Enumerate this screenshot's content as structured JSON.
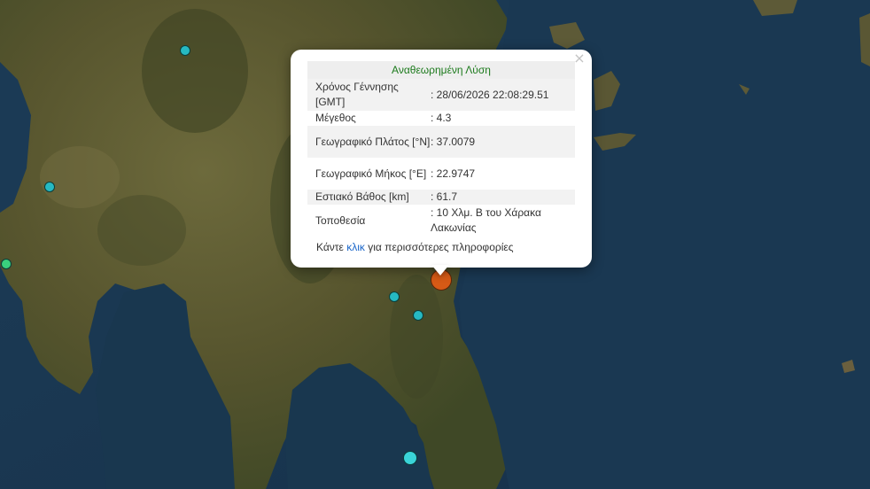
{
  "map": {
    "markers": [
      {
        "id": "m1",
        "size": "small",
        "color": "#26b9c2"
      },
      {
        "id": "m2",
        "size": "small",
        "color": "#26b9c2"
      },
      {
        "id": "m3",
        "size": "small",
        "color": "#3ad07d"
      },
      {
        "id": "m4",
        "size": "small",
        "color": "#3ad07d"
      },
      {
        "id": "m5",
        "size": "small",
        "color": "#26b9c2"
      },
      {
        "id": "m6",
        "size": "small",
        "color": "#26b9c2"
      },
      {
        "id": "m7",
        "size": "small",
        "color": "#3ad3d8"
      },
      {
        "id": "m8",
        "size": "large",
        "color": "#d65a16"
      }
    ]
  },
  "popup": {
    "close_icon": "×",
    "title": "Αναθεωρημένη Λύση",
    "rows": [
      {
        "label": "Χρόνος Γέννησης [GMT]",
        "value": ": 28/06/2026 22:08:29.51"
      },
      {
        "label": "Μέγεθος",
        "value": ": 4.3"
      },
      {
        "label": "Γεωγραφικό Πλάτος [°N]",
        "value": ": 37.0079"
      },
      {
        "label": "Γεωγραφικό Μήκος [°E]",
        "value": ": 22.9747"
      },
      {
        "label": "Εστιακό Βάθος [km]",
        "value": ": 61.7"
      },
      {
        "label": "Τοποθεσία",
        "value": ": 10 Χλμ. Β του Χάρακα Λακωνίας"
      }
    ],
    "more_prefix": "Κάντε ",
    "more_link": "κλικ",
    "more_suffix": " για περισσότερες πληροφορίες"
  }
}
